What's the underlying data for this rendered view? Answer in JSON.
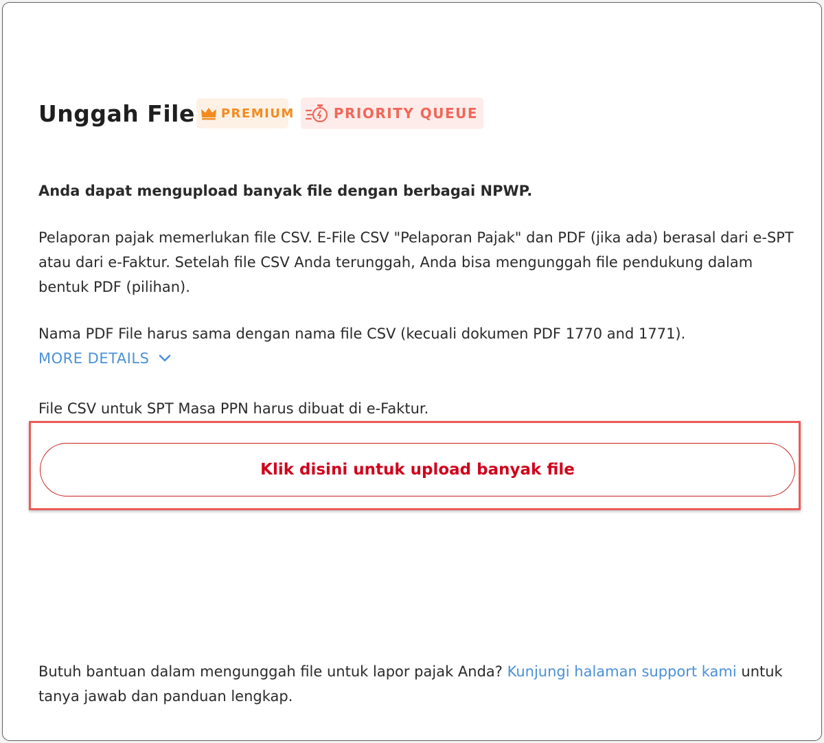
{
  "title": "Unggah File",
  "badges": {
    "premium": "PREMIUM",
    "priority": "PRIORITY QUEUE"
  },
  "intro": {
    "lead": "Anda dapat mengupload banyak file dengan berbagai NPWP.",
    "paragraph1": "Pelaporan pajak memerlukan file CSV. E-File CSV \"Pelaporan Pajak\" dan PDF (jika ada) berasal dari e-SPT atau dari e-Faktur. Setelah file CSV Anda terunggah, Anda bisa mengunggah file pendukung dalam bentuk PDF (pilihan).",
    "paragraph2": "Nama PDF File harus sama dengan nama file CSV (kecuali dokumen PDF 1770 and 1771).",
    "more_details": "MORE DETAILS",
    "paragraph3": "File CSV untuk SPT Masa PPN harus dibuat di e-Faktur."
  },
  "upload": {
    "button_label": "Klik disini untuk upload banyak file"
  },
  "help": {
    "text_before": "Butuh bantuan dalam mengunggah file untuk lapor pajak Anda? ",
    "link_text": "Kunjungi halaman support kami",
    "text_after": " untuk tanya jawab dan panduan lengkap."
  },
  "colors": {
    "premium": "#f28c21",
    "priority": "#f0675a",
    "link": "#4a90d9",
    "upload_text": "#d0021b",
    "highlight_frame": "#ec5a56"
  },
  "icons": {
    "premium": "crown-icon",
    "priority": "stopwatch-icon",
    "details": "chevron-down-icon"
  }
}
